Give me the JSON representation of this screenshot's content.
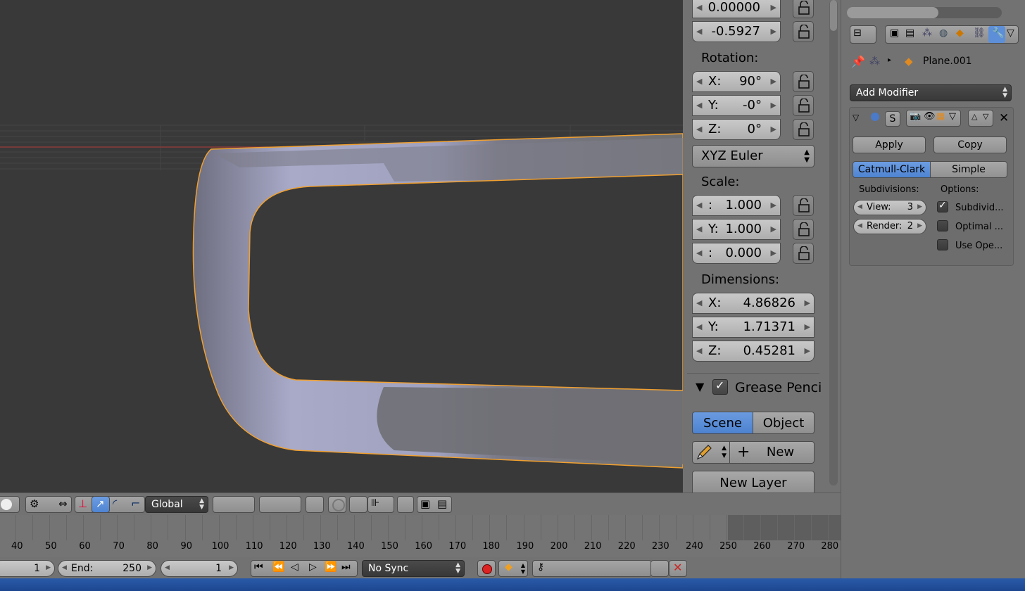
{
  "viewport": {
    "object_outline_color": "#f0a030"
  },
  "transform": {
    "location": [
      "0.00000",
      "-0.5927"
    ],
    "rotation_label": "Rotation:",
    "rotation": [
      {
        "axis": "X:",
        "value": "90°"
      },
      {
        "axis": "Y:",
        "value": "-0°"
      },
      {
        "axis": "Z:",
        "value": "0°"
      }
    ],
    "rotation_mode": "XYZ Euler",
    "scale_label": "Scale:",
    "scale": [
      {
        "axis": ":",
        "value": "1.000"
      },
      {
        "axis": "Y:",
        "value": "1.000"
      },
      {
        "axis": ":",
        "value": "0.000"
      }
    ],
    "dimensions_label": "Dimensions:",
    "dimensions": [
      {
        "axis": "X:",
        "value": "4.86826"
      },
      {
        "axis": "Y:",
        "value": "1.71371"
      },
      {
        "axis": "Z:",
        "value": "0.45281"
      }
    ]
  },
  "grease_pencil": {
    "title": "Grease Penci",
    "scene_label": "Scene",
    "object_label": "Object",
    "new_label": "New",
    "new_layer_label": "New Layer"
  },
  "viewport_header": {
    "orientation": "Global"
  },
  "timeline": {
    "frame_numbers": [
      "40",
      "50",
      "60",
      "70",
      "80",
      "90",
      "100",
      "110",
      "120",
      "130",
      "140",
      "150",
      "160",
      "170",
      "180",
      "190",
      "200",
      "210",
      "220",
      "230",
      "240",
      "250",
      "260",
      "270",
      "280"
    ],
    "start_value": "1",
    "end_label": "End:",
    "end_value": "250",
    "current_frame": "1",
    "sync_mode": "No Sync"
  },
  "properties": {
    "object_name": "Plane.001",
    "add_modifier": "Add Modifier",
    "modifier_s_label": "S",
    "apply_label": "Apply",
    "copy_label": "Copy",
    "catmull_label": "Catmull-Clark",
    "simple_label": "Simple",
    "subdivisions_label": "Subdivisions:",
    "options_label": "Options:",
    "view_label": "View:",
    "view_value": "3",
    "render_label": "Render:",
    "render_value": "2",
    "option_1": "Subdivid...",
    "option_2": "Optimal ...",
    "option_3": "Use Ope..."
  },
  "colors": {
    "accent": "#5b8fd9",
    "panel": "#727272",
    "viewport": "#393939"
  }
}
